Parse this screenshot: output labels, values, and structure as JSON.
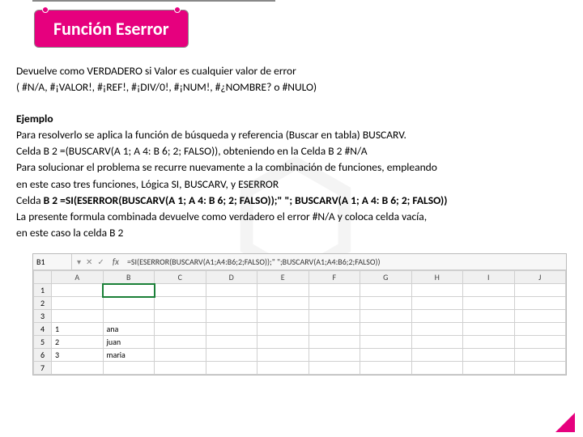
{
  "title": "Función Eserror",
  "intro_l1": "Devuelve como VERDADERO si Valor es cualquier valor de error",
  "intro_l2": " ( #N/A, #¡VALOR!, #¡REF!, #¡DIV/0!, #¡NUM!, #¿NOMBRE? o #NULO)",
  "ejemplo": "Ejemplo",
  "p1": "Para resolverlo se aplica la función de búsqueda y referencia (Buscar en tabla) BUSCARV.",
  "p2": "Celda B 2 =(BUSCARV(A 1; A 4: B 6; 2; FALSO)), obteniendo en la Celda B 2 #N/A",
  "p3": "Para solucionar el problema se recurre nuevamente a la combinación de funciones, empleando",
  "p4": "en este caso tres funciones, Lógica SI, BUSCARV, y ESERROR",
  "p5_a": "Celda  ",
  "p5_b": "B 2 =SI(ESERROR(BUSCARV(A 1; A 4: B 6; 2; FALSO));\" \"; BUSCARV(A 1; A 4: B 6; 2; FALSO))",
  "p6": "La presente formula combinada devuelve como verdadero el error  #N/A y coloca celda vacía,",
  "p7": "en este caso la celda  B 2",
  "excel": {
    "namebox": "B1",
    "formula": "=SI(ESERROR(BUSCARV(A1;A4:B6;2;FALSO));\" \";BUSCARV(A1;A4:B6;2;FALSO))",
    "cols": [
      "A",
      "B",
      "C",
      "D",
      "E",
      "F",
      "G",
      "H",
      "I",
      "J"
    ],
    "rows": [
      {
        "n": "1",
        "a": "",
        "b": ""
      },
      {
        "n": "2",
        "a": "",
        "b": ""
      },
      {
        "n": "3",
        "a": "",
        "b": ""
      },
      {
        "n": "4",
        "a": "1",
        "b": "ana"
      },
      {
        "n": "5",
        "a": "2",
        "b": "juan"
      },
      {
        "n": "6",
        "a": "3",
        "b": "maria"
      },
      {
        "n": "7",
        "a": "",
        "b": ""
      }
    ]
  }
}
